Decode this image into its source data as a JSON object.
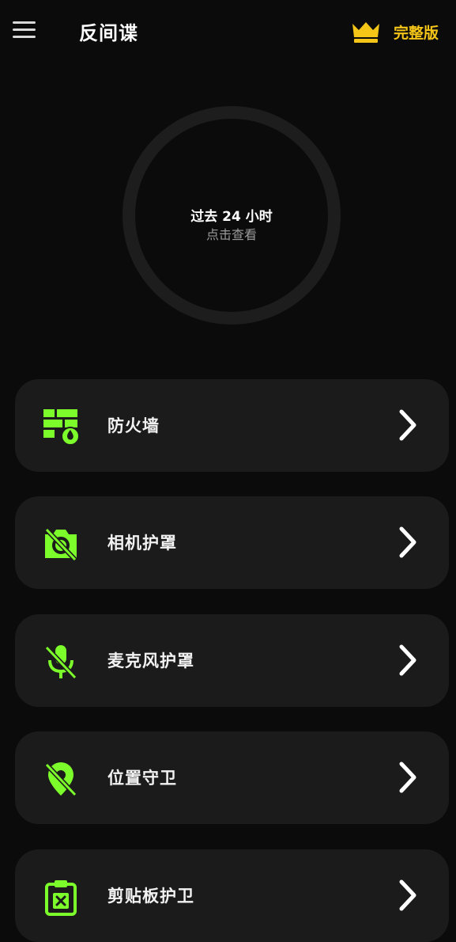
{
  "header": {
    "title": "反间谍",
    "upgrade_label": "完整版",
    "accent_color": "#f5c518"
  },
  "summary": {
    "title": "过去 24 小时",
    "subtitle": "点击查看"
  },
  "features": [
    {
      "label": "防火墙",
      "icon": "firewall-icon"
    },
    {
      "label": "相机护罩",
      "icon": "camera-off-icon"
    },
    {
      "label": "麦克风护罩",
      "icon": "mic-off-icon"
    },
    {
      "label": "位置守卫",
      "icon": "location-off-icon"
    },
    {
      "label": "剪贴板护卫",
      "icon": "clipboard-block-icon"
    }
  ],
  "icon_color": "#7cfc2a"
}
